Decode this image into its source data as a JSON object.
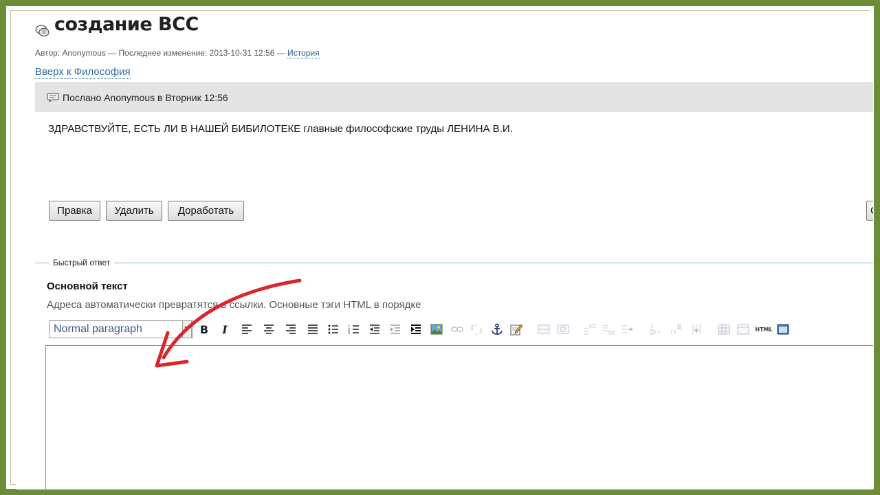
{
  "page": {
    "title": "создание ВСС",
    "meta": {
      "author_prefix": "Автор: Anonymous — Последнее изменение: 2013-10-31 12:56 —",
      "history_link": "История"
    },
    "breadcrumb_up": "Вверх к Философия"
  },
  "post": {
    "header": "Послано Anonymous в Вторник 12:56",
    "body": "ЗДРАВСТВУЙТЕ, ЕСТЬ ЛИ В НАШЕЙ БИБИЛОТЕКЕ главные философские труды ЛЕНИНА В.И.",
    "actions": {
      "edit": "Правка",
      "delete": "Удалить",
      "improve": "Доработать",
      "cut": "C"
    }
  },
  "quick_reply": {
    "legend": "Быстрый ответ",
    "body_label": "Основной текст",
    "body_hint": "Адреса автоматически превратятся в ссылки. Основные тэги HTML в порядке",
    "format_select": "Normal paragraph",
    "toolbar": {
      "bold": "B",
      "italic": "I",
      "html": "HTML"
    }
  },
  "colors": {
    "frame": "#6d8c35",
    "link": "#2d6aa6",
    "annotation": "#d8262a",
    "post_header_bg": "#e4e4e4"
  }
}
